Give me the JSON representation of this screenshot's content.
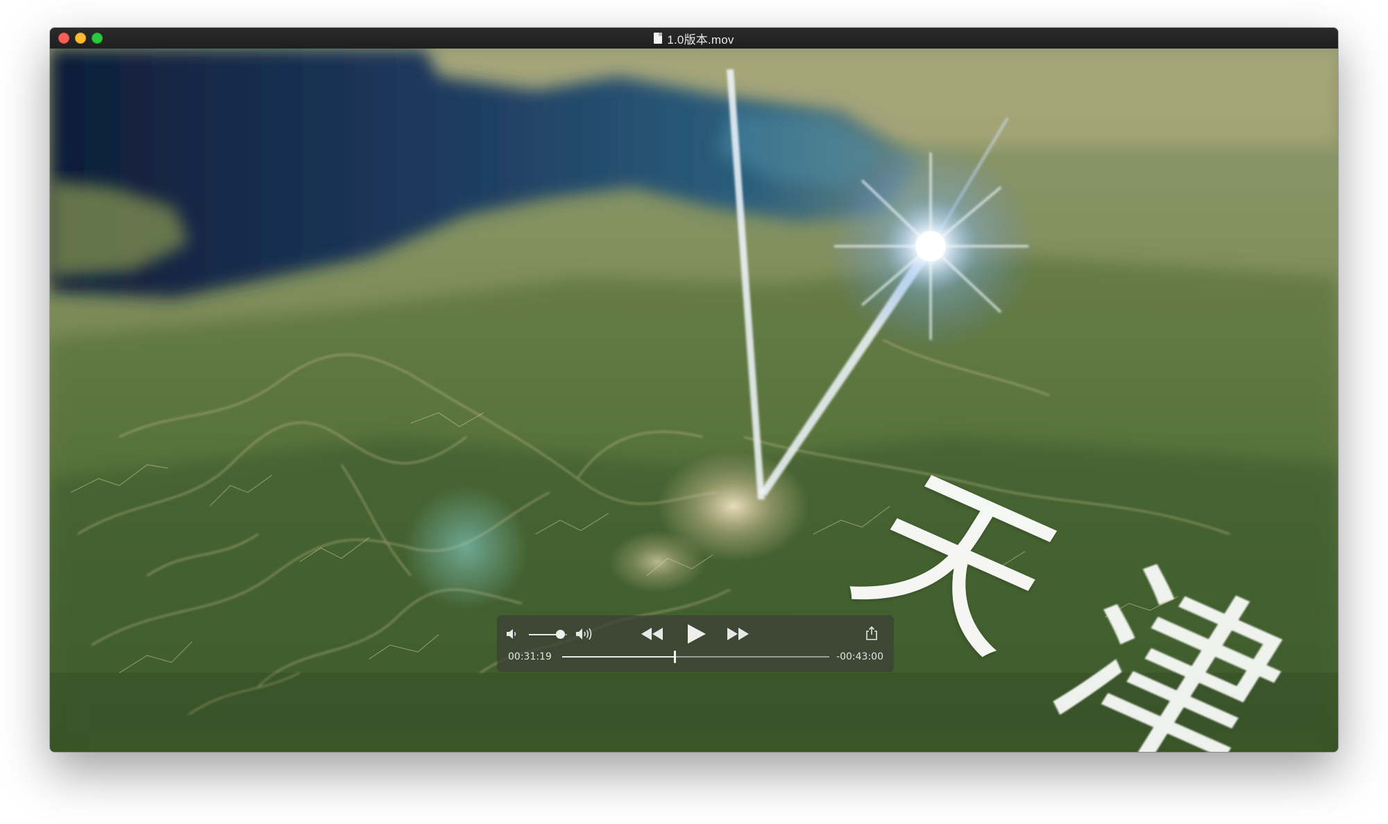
{
  "window": {
    "title": "1.0版本.mov"
  },
  "video": {
    "overlay_characters": [
      "天",
      "津"
    ]
  },
  "player": {
    "current_time": "00:31:19",
    "remaining_time": "-00:43:00",
    "progress": 0.42,
    "volume": 0.82,
    "icons": {
      "volume_low": "speaker-low-icon",
      "volume_high": "speaker-high-icon",
      "rewind": "rewind-icon",
      "play": "play-icon",
      "fast_forward": "fast-forward-icon",
      "share": "share-icon"
    }
  },
  "colors": {
    "titlebar": "#232323",
    "close": "#fc5f57",
    "minimize": "#fdbc2e",
    "maximize": "#28c840",
    "controls_bg": "#3a3e38"
  }
}
